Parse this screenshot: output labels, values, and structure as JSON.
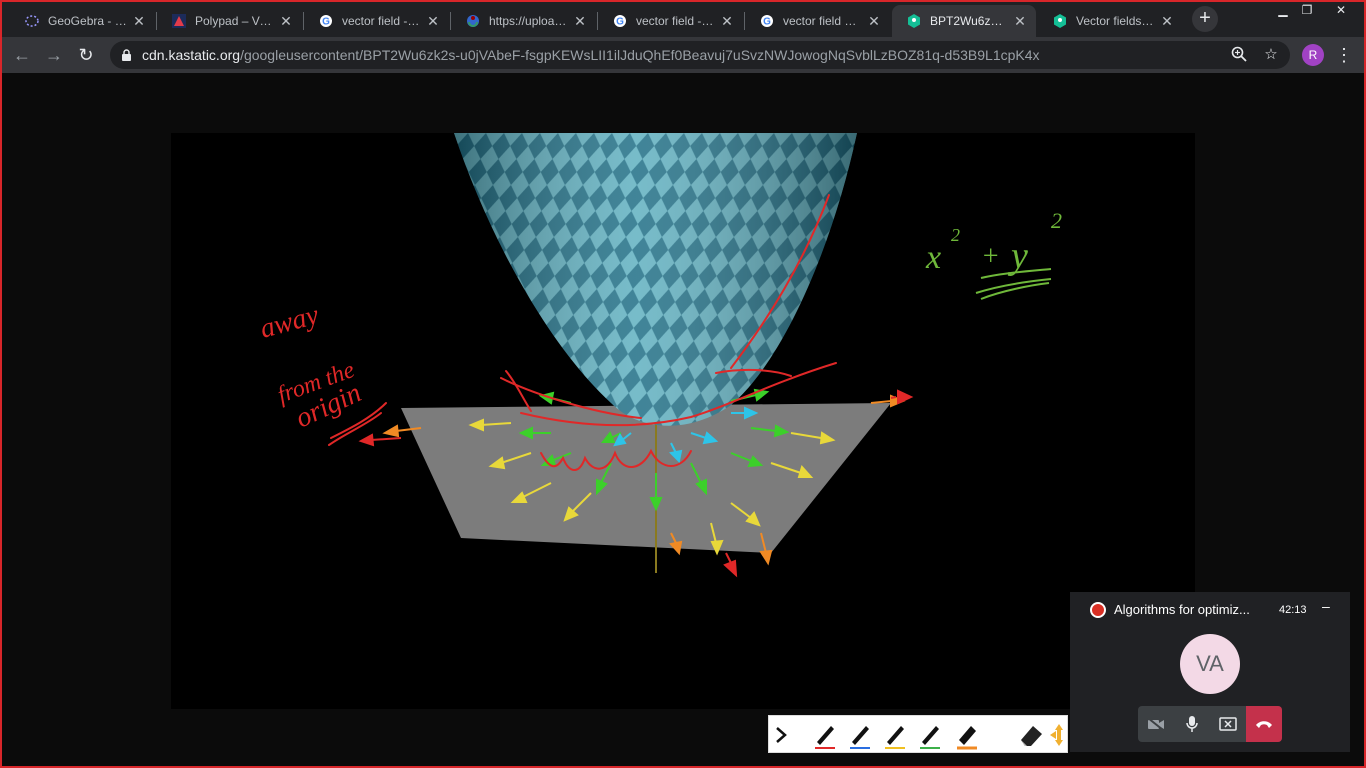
{
  "tabs": [
    {
      "title": "GeoGebra - Dyn",
      "icon": "geogebra-icon",
      "active": false
    },
    {
      "title": "Polypad – Virtu",
      "icon": "polypad-icon",
      "active": false
    },
    {
      "title": "vector field - Go",
      "icon": "google-icon",
      "active": false
    },
    {
      "title": "https://upload.w",
      "icon": "wikimedia-icon",
      "active": false
    },
    {
      "title": "vector field - Go",
      "icon": "google-icon",
      "active": false
    },
    {
      "title": "vector field kha",
      "icon": "google-icon",
      "active": false
    },
    {
      "title": "BPT2Wu6zk2s-u",
      "icon": "khan-academy-icon",
      "active": true
    },
    {
      "title": "Vector fields (ar",
      "icon": "khan-academy-icon",
      "active": false
    }
  ],
  "address": {
    "host": "cdn.kastatic.org",
    "path": "/googleusercontent/BPT2Wu6zk2s-u0jVAbeF-fsgpKEWsLII1ilJduQhEf0Beavuj7uSvzNWJowogNqSvblLzBOZ81q-d53B9L1cpK4x"
  },
  "profile": {
    "initial": "R"
  },
  "meeting": {
    "title": "Algorithms for optimiz...",
    "time": "42:13",
    "avatar": "VA",
    "minimize": "–"
  },
  "annotations": {
    "formula_x": "x",
    "formula_y": "y",
    "formula_exp": "2",
    "plus": "+",
    "away": "away",
    "from_the": "from the",
    "origin": "origin"
  },
  "colors": {
    "accent_red": "#d8262a",
    "record_red": "#d93025",
    "hangup_red": "#c4314b",
    "ink_red": "#e02828",
    "ink_green": "#6fb83a"
  }
}
